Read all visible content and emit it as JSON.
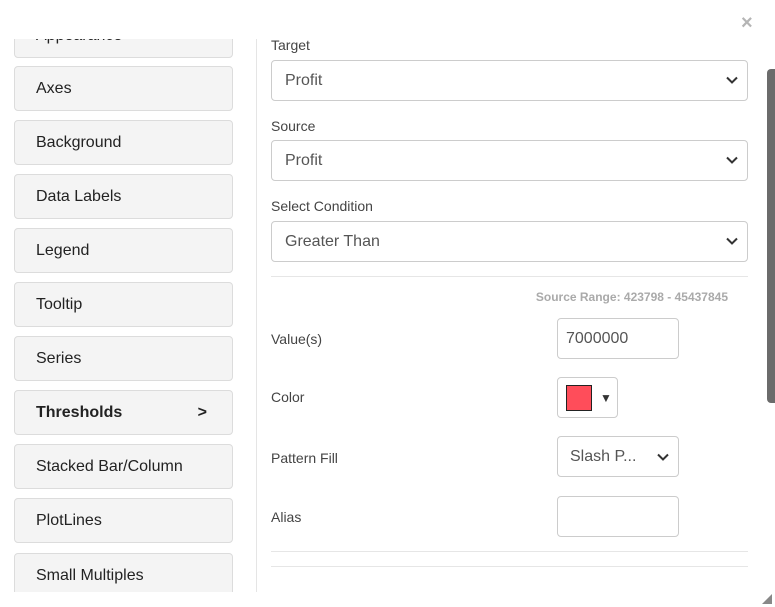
{
  "dialog": {
    "close_label": "×"
  },
  "sidebar": {
    "items": [
      {
        "label": "Appearance"
      },
      {
        "label": "Axes"
      },
      {
        "label": "Background"
      },
      {
        "label": "Data Labels"
      },
      {
        "label": "Legend"
      },
      {
        "label": "Tooltip"
      },
      {
        "label": "Series"
      },
      {
        "label": "Thresholds",
        "active": true,
        "indicator": ">"
      },
      {
        "label": "Stacked Bar/Column"
      },
      {
        "label": "PlotLines"
      },
      {
        "label": "Small Multiples"
      }
    ]
  },
  "form": {
    "target": {
      "label": "Target",
      "value": "Profit"
    },
    "source": {
      "label": "Source",
      "value": "Profit"
    },
    "condition": {
      "label": "Select Condition",
      "value": "Greater Than"
    },
    "source_range": "Source Range: 423798 - 45437845",
    "values": {
      "label": "Value(s)",
      "value": "7000000"
    },
    "color": {
      "label": "Color",
      "value": "#ff4d5a",
      "caret": "▼"
    },
    "pattern_fill": {
      "label": "Pattern Fill",
      "value": "Slash P..."
    },
    "alias": {
      "label": "Alias",
      "value": ""
    }
  }
}
